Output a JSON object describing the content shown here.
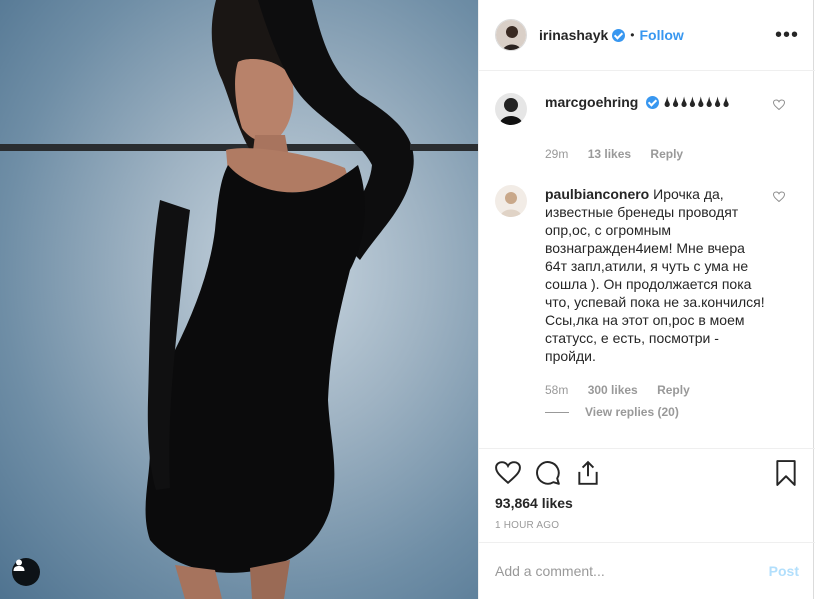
{
  "post": {
    "author": "irinashayk",
    "follow_label": "Follow",
    "separator": "•",
    "more_label": "•••"
  },
  "comments": [
    {
      "user": "marcgoehring",
      "verified": true,
      "text": "🌢🌢🌢🌢🌢🌢🌢🌢",
      "time": "29m",
      "likes": "13 likes",
      "reply": "Reply"
    },
    {
      "user": "paulbianconero",
      "verified": false,
      "text": "Ирочка да, известные бренеды проводят опр,ос, с огромным вознагражден4ием! Мне вчера 64т запл,атили, я чуть с ума не сошла ). Он продолжается пока что, успевай пока не за.кончился! Ссы,лка на этот оп,рос в моем статусс, е есть, посмотри - пройди.",
      "time": "58m",
      "likes": "300 likes",
      "reply": "Reply",
      "view_replies": "View replies (20)"
    }
  ],
  "stats": {
    "likes": "93,864 likes",
    "timestamp": "1 HOUR AGO"
  },
  "composer": {
    "placeholder": "Add a comment...",
    "post_label": "Post"
  },
  "icons": {
    "like": "heart-icon",
    "comment": "comment-icon",
    "share": "share-icon",
    "save": "bookmark-icon",
    "verified": "verified-badge-icon",
    "more": "more-options-icon",
    "user_tag": "user-tag-icon"
  },
  "colors": {
    "link_blue": "#3897f0",
    "post_disabled": "#b2dffc",
    "muted": "#999999",
    "text": "#262626"
  }
}
